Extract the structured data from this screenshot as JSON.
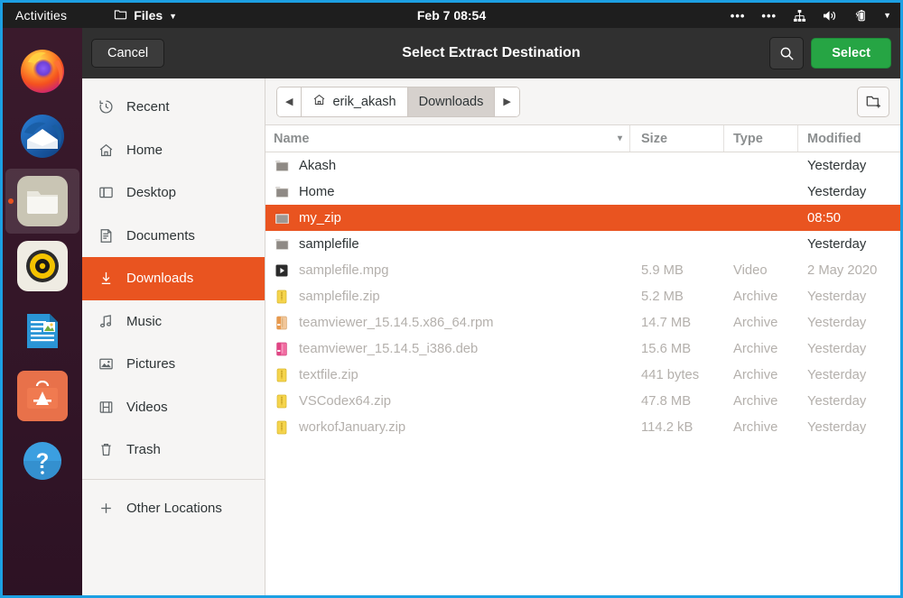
{
  "panel": {
    "activities": "Activities",
    "app_name": "Files",
    "app_icon": "folder-icon",
    "caret": "▼",
    "clock": "Feb 7  08:54",
    "dots_left": "•••",
    "dots_right": "•••",
    "icons": [
      "network-icon",
      "volume-icon",
      "battery-charging-icon"
    ],
    "menu_caret": "▼"
  },
  "dock": {
    "items": [
      {
        "name": "firefox",
        "label": "Firefox",
        "active": false
      },
      {
        "name": "thunderbird",
        "label": "Thunderbird",
        "active": false
      },
      {
        "name": "files",
        "label": "Files",
        "active": true
      },
      {
        "name": "rhythmbox",
        "label": "Rhythmbox",
        "active": false
      },
      {
        "name": "libreoffice",
        "label": "LibreOffice Writer",
        "active": false
      },
      {
        "name": "ubuntu-software",
        "label": "Ubuntu Software",
        "active": false
      },
      {
        "name": "help",
        "label": "Help",
        "active": false
      }
    ]
  },
  "dialog": {
    "title": "Select Extract Destination",
    "cancel_label": "Cancel",
    "select_label": "Select",
    "search_icon": "search-icon",
    "new_folder_icon": "new-folder-icon"
  },
  "sidebar": {
    "items": [
      {
        "label": "Recent",
        "icon": "clock-icon",
        "selected": false
      },
      {
        "label": "Home",
        "icon": "home-icon",
        "selected": false
      },
      {
        "label": "Desktop",
        "icon": "desktop-icon",
        "selected": false
      },
      {
        "label": "Documents",
        "icon": "document-icon",
        "selected": false
      },
      {
        "label": "Downloads",
        "icon": "download-icon",
        "selected": true
      },
      {
        "label": "Music",
        "icon": "music-note-icon",
        "selected": false
      },
      {
        "label": "Pictures",
        "icon": "picture-icon",
        "selected": false
      },
      {
        "label": "Videos",
        "icon": "film-icon",
        "selected": false
      },
      {
        "label": "Trash",
        "icon": "trash-icon",
        "selected": false
      }
    ],
    "other_locations": {
      "label": "Other Locations",
      "icon": "plus-icon"
    }
  },
  "pathbar": {
    "back_arrow": "◀",
    "forward_arrow": "▶",
    "crumbs": [
      {
        "label": "erik_akash",
        "icon": "home-icon",
        "current": false
      },
      {
        "label": "Downloads",
        "icon": "",
        "current": true
      }
    ]
  },
  "columns": {
    "name": "Name",
    "size": "Size",
    "type": "Type",
    "modified": "Modified",
    "sort_caret": "▾"
  },
  "files": [
    {
      "name": "Akash",
      "size": "",
      "type": "",
      "modified": "Yesterday",
      "kind": "folder",
      "icon": "folder-icon",
      "selected": false
    },
    {
      "name": "Home",
      "size": "",
      "type": "",
      "modified": "Yesterday",
      "kind": "folder",
      "icon": "folder-icon",
      "selected": false
    },
    {
      "name": "my_zip",
      "size": "",
      "type": "",
      "modified": "08:50",
      "kind": "folder",
      "icon": "folder-icon",
      "selected": true
    },
    {
      "name": "samplefile",
      "size": "",
      "type": "",
      "modified": "Yesterday",
      "kind": "folder",
      "icon": "folder-icon",
      "selected": false
    },
    {
      "name": "samplefile.mpg",
      "size": "5.9 MB",
      "type": "Video",
      "modified": "2 May 2020",
      "kind": "file",
      "icon": "video-file-icon",
      "selected": false
    },
    {
      "name": "samplefile.zip",
      "size": "5.2 MB",
      "type": "Archive",
      "modified": "Yesterday",
      "kind": "file",
      "icon": "zip-file-icon",
      "selected": false
    },
    {
      "name": "teamviewer_15.14.5.x86_64.rpm",
      "size": "14.7 MB",
      "type": "Archive",
      "modified": "Yesterday",
      "kind": "file",
      "icon": "rpm-file-icon",
      "selected": false
    },
    {
      "name": "teamviewer_15.14.5_i386.deb",
      "size": "15.6 MB",
      "type": "Archive",
      "modified": "Yesterday",
      "kind": "file",
      "icon": "deb-file-icon",
      "selected": false
    },
    {
      "name": "textfile.zip",
      "size": "441 bytes",
      "type": "Archive",
      "modified": "Yesterday",
      "kind": "file",
      "icon": "zip-file-icon",
      "selected": false
    },
    {
      "name": "VSCodex64.zip",
      "size": "47.8 MB",
      "type": "Archive",
      "modified": "Yesterday",
      "kind": "file",
      "icon": "zip-file-icon",
      "selected": false
    },
    {
      "name": "workofJanuary.zip",
      "size": "114.2 kB",
      "type": "Archive",
      "modified": "Yesterday",
      "kind": "file",
      "icon": "zip-file-icon",
      "selected": false
    }
  ],
  "colors": {
    "ubuntu_orange": "#E95420",
    "select_green": "#26A544",
    "panel_dark": "#1E1E1E",
    "headerbar_dark": "#303030",
    "sidebar_bg": "#F6F5F4",
    "screenshot_border": "#1CA0E3"
  }
}
